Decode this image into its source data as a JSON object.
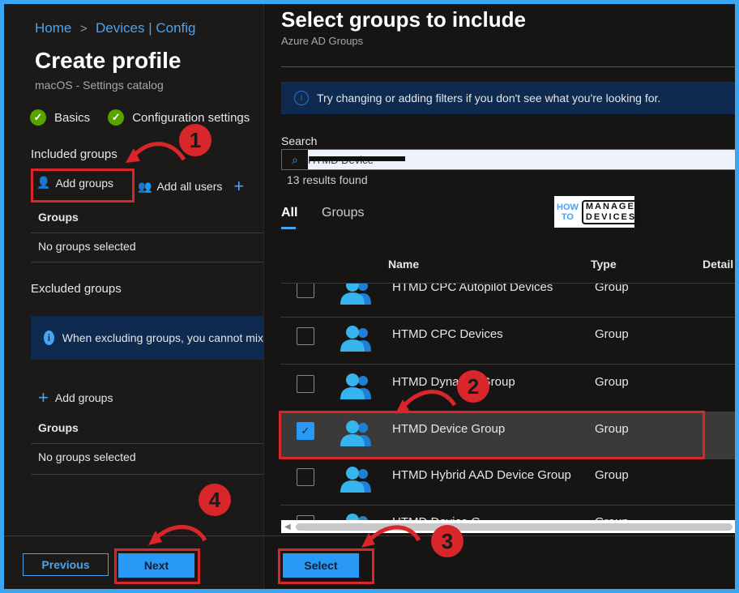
{
  "left": {
    "breadcrumb": {
      "home": "Home",
      "sep": ">",
      "devices": "Devices | Config"
    },
    "title": "Create profile",
    "subtitle": "macOS - Settings catalog",
    "steps": [
      {
        "label": "Basics",
        "status": "complete"
      },
      {
        "label": "Configuration settings",
        "status": "complete"
      }
    ],
    "included": {
      "heading": "Included groups",
      "add_groups": "Add groups",
      "add_all_users": "Add all users",
      "col_header": "Groups",
      "empty": "No groups selected"
    },
    "excluded": {
      "heading": "Excluded groups",
      "info": "When excluding groups, you cannot mix",
      "add_groups": "Add groups",
      "col_header": "Groups",
      "empty": "No groups selected"
    },
    "footer": {
      "previous": "Previous",
      "next": "Next"
    }
  },
  "right": {
    "title": "Select groups to include",
    "subtitle": "Azure AD Groups",
    "info": "Try changing or adding filters if you don't see what you're looking for.",
    "search_label": "Search",
    "search_value": "HTMD Device",
    "results": "13 results found",
    "tabs": [
      {
        "label": "All",
        "active": true
      },
      {
        "label": "Groups",
        "active": false
      }
    ],
    "logo": {
      "how": "HOW",
      "to": "TO",
      "manage": "MANAGE",
      "devices": "DEVICES"
    },
    "columns": {
      "name": "Name",
      "type": "Type",
      "details": "Detail"
    },
    "rows": [
      {
        "name": "HTMD CPC Autopilot Devices",
        "type": "Group",
        "checked": false
      },
      {
        "name": "HTMD CPC Devices",
        "type": "Group",
        "checked": false
      },
      {
        "name": "HTMD Dynamic Group",
        "type": "Group",
        "checked": false
      },
      {
        "name": "HTMD Device Group",
        "type": "Group",
        "checked": true
      },
      {
        "name": "HTMD Hybrid AAD Device Group",
        "type": "Group",
        "checked": false
      },
      {
        "name": "HTMD Device G",
        "type": "Group",
        "checked": false
      }
    ],
    "select": "Select"
  },
  "annotations": {
    "step1": "1",
    "step2": "2",
    "step3": "3",
    "step4": "4"
  },
  "colors": {
    "accent": "#2899f5",
    "highlight": "#d9262b",
    "frame": "#3aa6f2",
    "success": "#57a300"
  }
}
